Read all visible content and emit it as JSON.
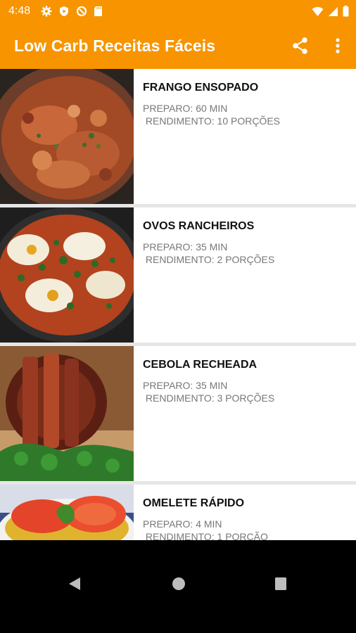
{
  "status_bar": {
    "time": "4:48"
  },
  "app_bar": {
    "title": "Low Carb Receitas Fáceis",
    "icons": [
      "share-icon",
      "more-vert-icon"
    ]
  },
  "recipes": [
    {
      "name": "FRANGO ENSOPADO",
      "preparo": "PREPARO: 60 MIN",
      "rendimento": " RENDIMENTO: 10 PORÇÕES"
    },
    {
      "name": "OVOS RANCHEIROS",
      "preparo": "PREPARO: 35 MIN",
      "rendimento": " RENDIMENTO: 2 PORÇÕES"
    },
    {
      "name": "CEBOLA RECHEADA",
      "preparo": "PREPARO: 35 MIN",
      "rendimento": " RENDIMENTO: 3 PORÇÕES"
    },
    {
      "name": "OMELETE RÁPIDO",
      "preparo": "PREPARO: 4 MIN",
      "rendimento": " RENDIMENTO: 1 PORÇÃO"
    }
  ],
  "colors": {
    "accent": "#F79400",
    "text": "#111111",
    "muted": "#777777"
  }
}
